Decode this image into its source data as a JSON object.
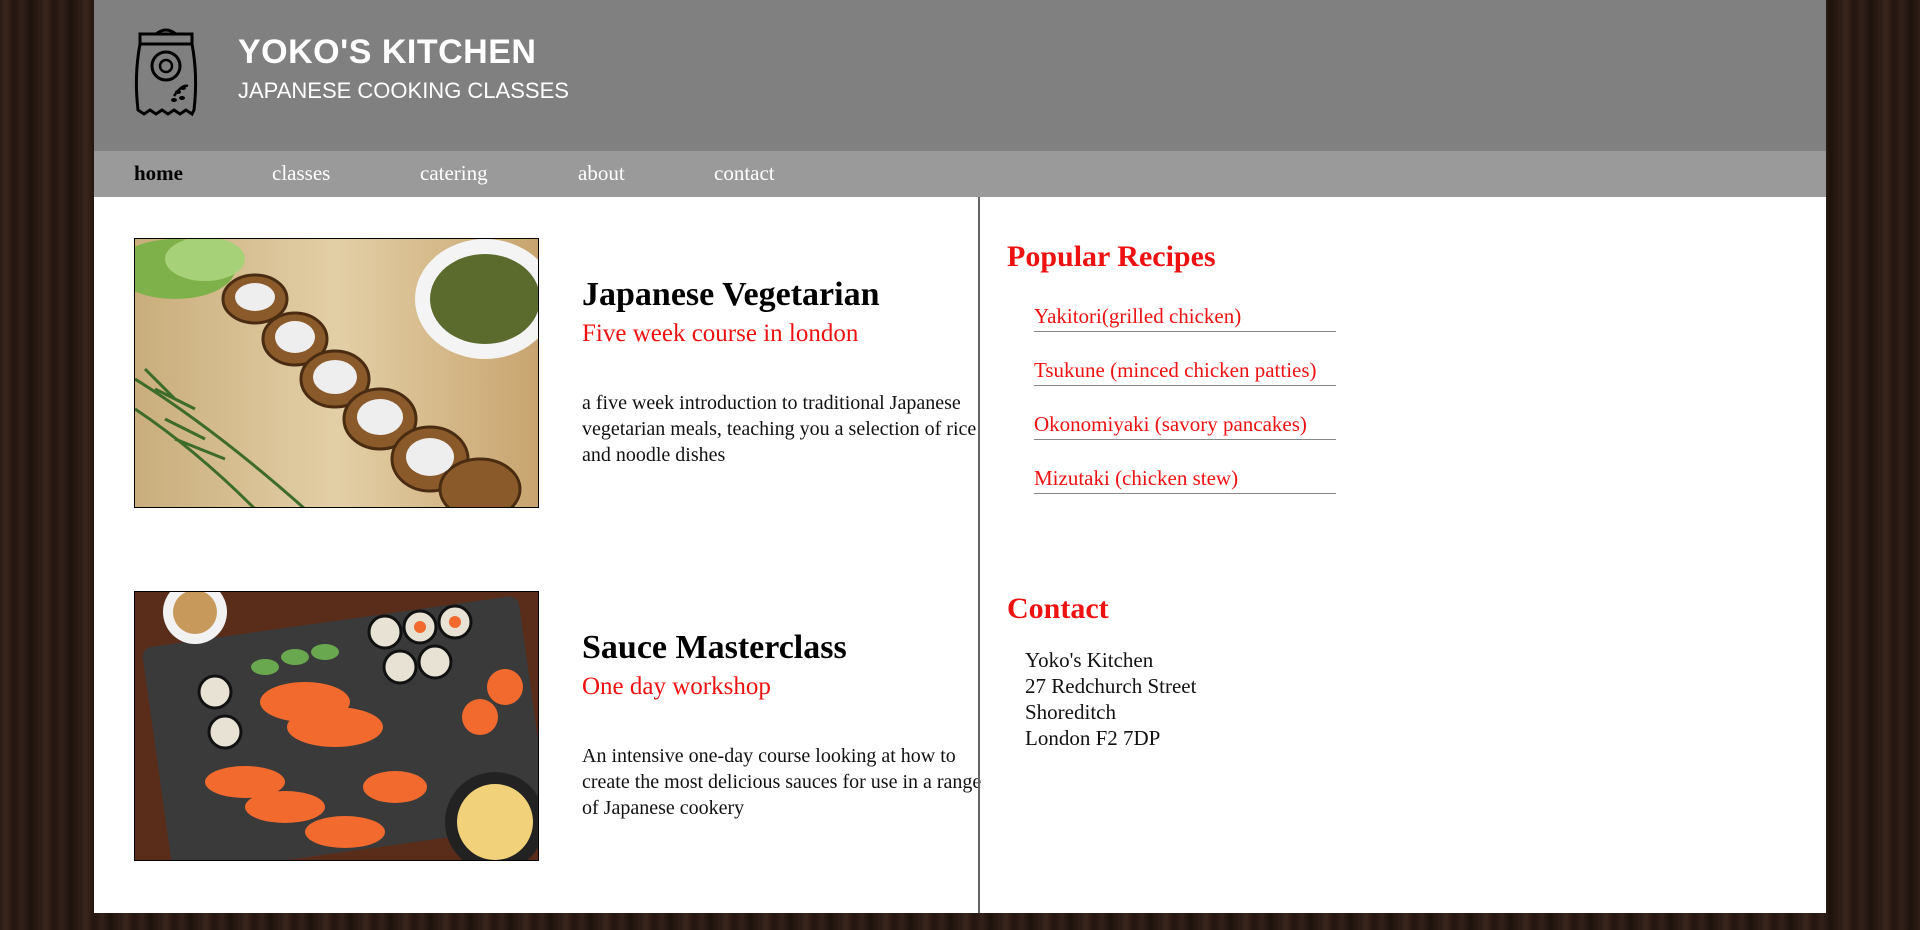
{
  "header": {
    "title": "YOKO'S KITCHEN",
    "subtitle": "JAPANESE COOKING CLASSES"
  },
  "nav": {
    "items": [
      {
        "label": "home",
        "active": true
      },
      {
        "label": "classes",
        "active": false
      },
      {
        "label": "catering",
        "active": false
      },
      {
        "label": "about",
        "active": false
      },
      {
        "label": "contact",
        "active": false
      }
    ]
  },
  "courses": [
    {
      "title": "Japanese Vegetarian",
      "subtitle": "Five week course in london",
      "description": "a five week introduction to traditional Japanese vegetarian meals, teaching you a selection of rice and noodle dishes"
    },
    {
      "title": "Sauce Masterclass",
      "subtitle": "One day workshop",
      "description": "An intensive one-day course looking at how to create the most delicious sauces for use in a range of Japanese cookery"
    }
  ],
  "sidebar": {
    "recipes_heading": "Popular Recipes",
    "recipes": [
      "Yakitori(grilled chicken)",
      "Tsukune (minced chicken patties)",
      "Okonomiyaki (savory pancakes)",
      "Mizutaki (chicken stew)"
    ],
    "contact_heading": "Contact",
    "contact_lines": [
      "Yoko's Kitchen",
      "27 Redchurch Street",
      "Shoreditch",
      "London F2 7DP"
    ]
  },
  "colors": {
    "accent": "#ee1111",
    "header_bg": "#808080",
    "nav_bg": "#9a9a9a"
  }
}
